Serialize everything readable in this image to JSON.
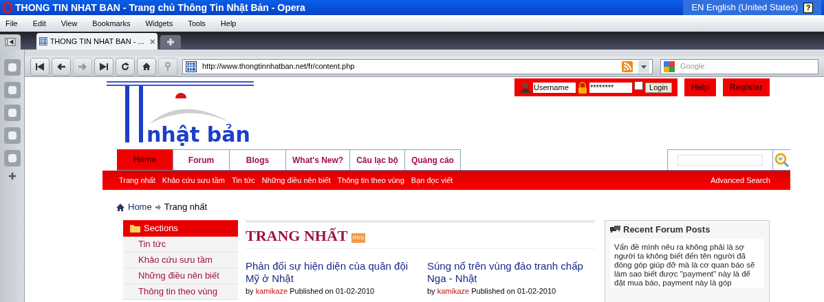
{
  "window": {
    "title": "THONG TIN NHAT BAN - Trang chủ Thông Tin Nhật Bản - Opera",
    "language": "EN English (United States)",
    "help_glyph": "?"
  },
  "menu": [
    "File",
    "Edit",
    "View",
    "Bookmarks",
    "Widgets",
    "Tools",
    "Help"
  ],
  "tabs": [
    {
      "label": "THONG TIN NHAT BAN - ...",
      "selected": true
    }
  ],
  "address": {
    "url": "http://www.thongtinnhatban.net/fr/content.php",
    "search_placeholder": "Google"
  },
  "page": {
    "logo": {
      "text": "nhật bản"
    },
    "login": {
      "username": "Username",
      "password": "********",
      "remember_checked": false,
      "button": "Login"
    },
    "top_buttons": [
      "Help",
      "Register"
    ],
    "nav": [
      {
        "label": "Home",
        "selected": true
      },
      {
        "label": "Forum",
        "selected": false
      },
      {
        "label": "Blogs",
        "selected": false
      },
      {
        "label": "What's New?",
        "selected": false
      },
      {
        "label": "Câu lạc bộ",
        "selected": false
      },
      {
        "label": "Quảng cáo",
        "selected": false
      }
    ],
    "subnav": [
      "Trang nhất",
      "Khảo cứu sưu tầm",
      "Tin tức",
      "Những điều nên biết",
      "Thông tin theo vùng",
      "Bạn đọc viết"
    ],
    "advanced_search": "Advanced Search",
    "breadcrumb": [
      "Home",
      "Trang nhất"
    ],
    "sections": {
      "title": "Sections",
      "items": [
        "Tin tức",
        "Khảo cứu sưu tầm",
        "Những điều nên biết",
        "Thông tin theo vùng"
      ]
    },
    "main": {
      "heading": "TRANG NHẤT",
      "rss": "RSS",
      "articles": [
        {
          "title": "Phản đối sự hiện diện của quân đội Mỹ ở Nhật",
          "by": "by",
          "author": "kamikaze",
          "published": "Published on 01-02-2010"
        },
        {
          "title": "Súng nổ trên vùng đảo tranh chấp Nga - Nhật",
          "by": "by",
          "author": "kamikaze",
          "published": "Published on 01-02-2010"
        }
      ]
    },
    "forum": {
      "title": "Recent Forum Posts",
      "text": "Vấn đề mình nêu ra không phải là sợ người ta không biết đến tên người đã đóng góp giúp đỡ mà là cơ quan báo sẽ làm sao biết được \"payment\" này là để đặt mua báo, payment này là góp"
    }
  }
}
